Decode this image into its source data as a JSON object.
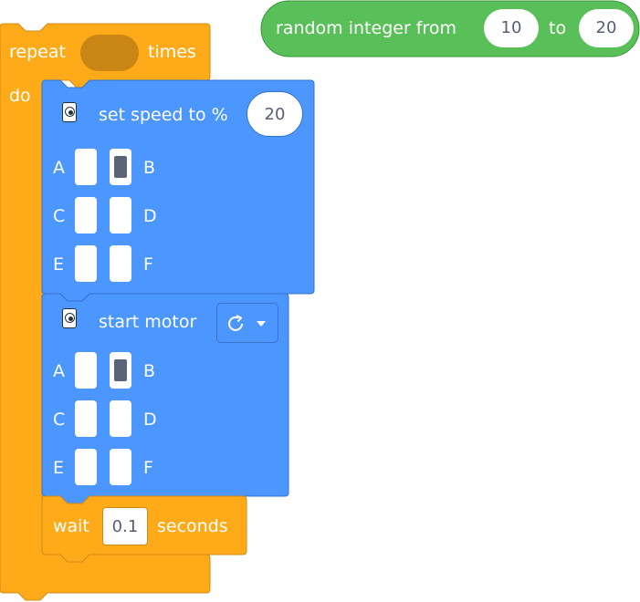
{
  "random_block": {
    "label_prefix": "random integer from",
    "min_value": "10",
    "label_mid": "to",
    "max_value": "20"
  },
  "repeat_block": {
    "label_repeat": "repeat",
    "label_times": "times",
    "label_do": "do"
  },
  "set_speed_block": {
    "label": "set speed to %",
    "speed_value": "20",
    "ports": [
      {
        "left": "A",
        "right": "B"
      },
      {
        "left": "C",
        "right": "D"
      },
      {
        "left": "E",
        "right": "F"
      }
    ],
    "selected_port": "B"
  },
  "start_motor_block": {
    "label": "start motor",
    "direction_icon": "clockwise-arrow-icon",
    "ports": [
      {
        "left": "A",
        "right": "B"
      },
      {
        "left": "C",
        "right": "D"
      },
      {
        "left": "E",
        "right": "F"
      }
    ],
    "selected_port": "B"
  },
  "wait_block": {
    "label_wait": "wait",
    "duration_value": "0.1",
    "label_seconds": "seconds"
  },
  "colors": {
    "control_orange": "#ffab19",
    "control_orange_dark": "#cf8b17",
    "motor_blue": "#4c97ff",
    "motor_blue_dark": "#3373cc",
    "operator_green": "#59c059",
    "operator_green_dark": "#389438",
    "empty_slot": "#c98614"
  }
}
